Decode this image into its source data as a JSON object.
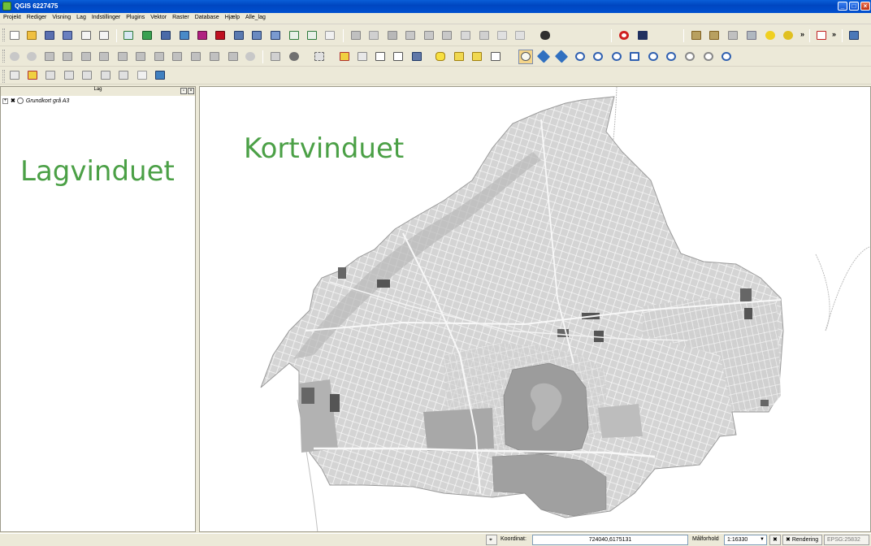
{
  "window": {
    "title": "QGIS 6227475"
  },
  "menu": [
    "Projekt",
    "Rediger",
    "Visning",
    "Lag",
    "Indstillinger",
    "Plugins",
    "Vektor",
    "Raster",
    "Database",
    "Hjælp",
    "Alle_lag"
  ],
  "layers_panel": {
    "title": "Lag",
    "layers": [
      {
        "name": "Grundkort grå A3"
      }
    ]
  },
  "annotations": {
    "layers_window": "Lagvinduet",
    "map_window": "Kortvinduet"
  },
  "statusbar": {
    "coordinate_label": "Koordinat:",
    "coordinate_value": "724040,6175131",
    "scale_label": "Målforhold",
    "scale_value": "1:16330",
    "render_label": "Rendering",
    "crs": "EPSG:25832"
  },
  "colors": {
    "titlebar": "#0050d0",
    "accent_green": "#4ba046",
    "map_fill": "#d6d6d6"
  }
}
